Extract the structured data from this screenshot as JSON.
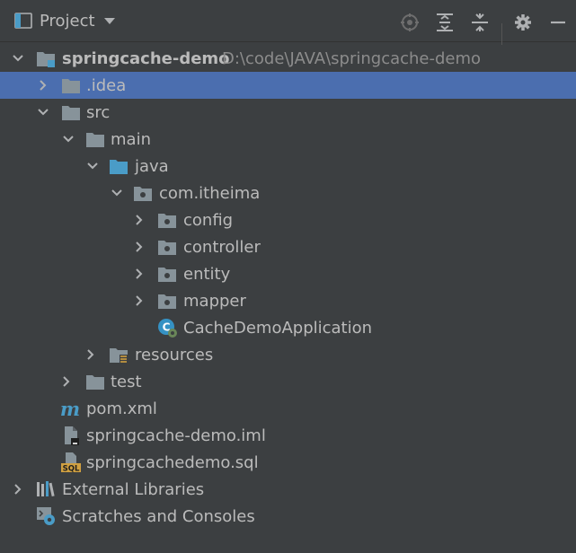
{
  "header": {
    "title": "Project",
    "icons": [
      "locate-icon",
      "expand-all-icon",
      "collapse-all-icon",
      "settings-icon",
      "minimize-icon"
    ]
  },
  "tree": {
    "root": {
      "label": "springcache-demo",
      "path": "D:\\code\\JAVA\\springcache-demo"
    },
    "idea": ".idea",
    "src": "src",
    "main": "main",
    "java": "java",
    "package": "com.itheima",
    "config": "config",
    "controller": "controller",
    "entity": "entity",
    "mapper": "mapper",
    "app_class": "CacheDemoApplication",
    "resources": "resources",
    "test": "test",
    "pom": "pom.xml",
    "iml": "springcache-demo.iml",
    "sql": "springcachedemo.sql",
    "external_libs": "External Libraries",
    "scratches": "Scratches and Consoles",
    "sql_badge": "SQL",
    "maven_badge": "m"
  },
  "colors": {
    "background": "#3c3f41",
    "selection": "#4b6eaf",
    "folder": "#87939a",
    "source_folder": "#4a9cc7",
    "text": "#bbbbbb",
    "path_text": "#8c8c8c"
  }
}
